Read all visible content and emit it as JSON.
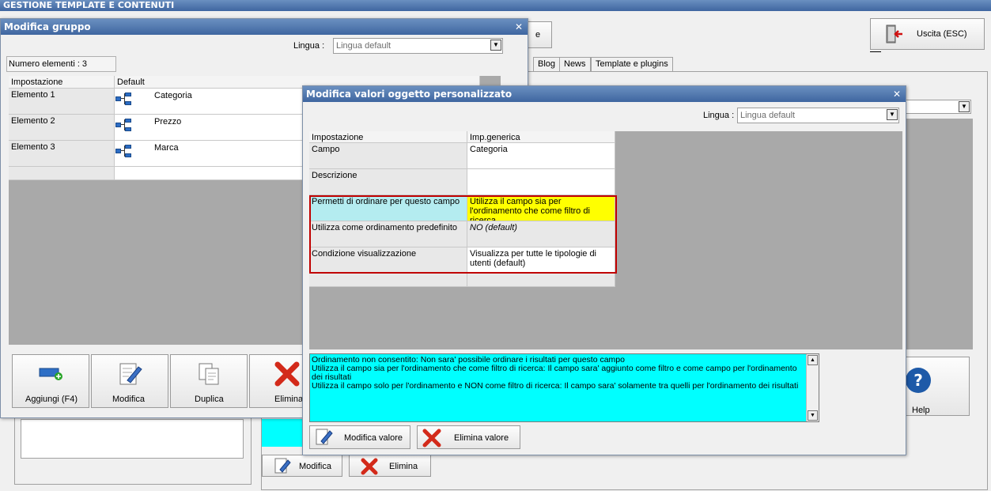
{
  "app": {
    "title": "GESTIONE TEMPLATE E CONTENUTI",
    "exit_label": "Uscita (ESC)",
    "tabs": [
      "Blog",
      "News",
      "Template e plugins"
    ],
    "help_label": "Help",
    "hidden_button_fragment": "e",
    "bottom_modifica": "Modifica",
    "bottom_elimina": "Elimina"
  },
  "group_window": {
    "title": "Modifica gruppo",
    "lingua_label": "Lingua :",
    "lingua_value": "Lingua default",
    "count_label": "Numero elementi : 3",
    "columns": [
      "Impostazione",
      "Default"
    ],
    "rows": [
      {
        "label": "Elemento 1",
        "value": "Categoria"
      },
      {
        "label": "Elemento 2",
        "value": "Prezzo"
      },
      {
        "label": "Elemento 3",
        "value": "Marca"
      }
    ],
    "buttons": {
      "add": "Aggiungi (F4)",
      "edit": "Modifica",
      "duplicate": "Duplica",
      "delete": "Elimina"
    }
  },
  "values_window": {
    "title": "Modifica valori oggetto personalizzato",
    "lingua_label": "Lingua :",
    "lingua_value": "Lingua default",
    "columns": [
      "Impostazione",
      "Imp.generica"
    ],
    "rows": [
      {
        "label": "Campo",
        "value": "Categoria"
      },
      {
        "label": "Descrizione",
        "value": ""
      },
      {
        "label": "Permetti di ordinare per questo campo",
        "value": "Utilizza il campo sia per l'ordinamento che come filtro di ricerca"
      },
      {
        "label": "Utilizza come ordinamento predefinito",
        "value": "NO (default)"
      },
      {
        "label": "Condizione visualizzazione",
        "value": "Visualizza per tutte le tipologie di utenti (default)"
      }
    ],
    "info_text": [
      "Ordinamento non consentito: Non sara' possibile ordinare i risultati per questo campo",
      "Utilizza il campo sia per l'ordinamento che come filtro di ricerca: Il campo sara' aggiunto come filtro e come campo per l'ordinamento dei risultati",
      "Utilizza il campo solo per l'ordinamento e NON come filtro di ricerca: Il campo sara' solamente tra quelli per l'ordinamento dei risultati"
    ],
    "edit_value_label": "Modifica valore",
    "delete_value_label": "Elimina valore"
  },
  "colors": {
    "highlight_label": "#b4ecf0",
    "highlight_value": "#ffff00",
    "selection_border": "#c00000",
    "info_bg": "#00ffff",
    "title_bar": "#4a72aa"
  }
}
